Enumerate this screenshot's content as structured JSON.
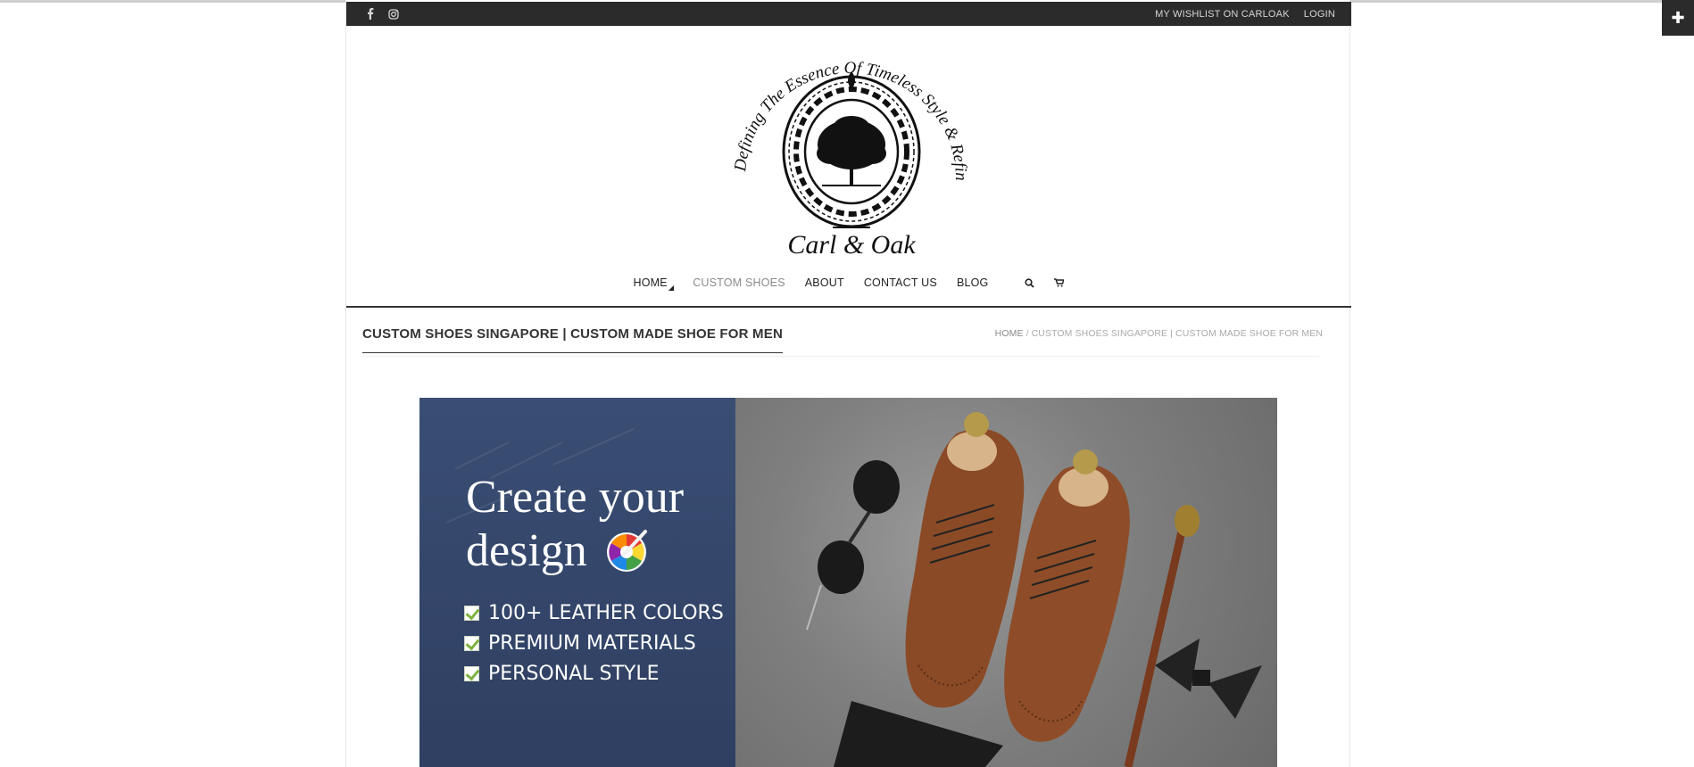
{
  "topbar": {
    "social": [
      {
        "icon": "facebook-icon",
        "glyph": "f"
      },
      {
        "icon": "instagram-icon",
        "glyph": ""
      }
    ],
    "wishlist_label": "MY WISHLIST ON CARLOAK",
    "login_label": "LOGIN"
  },
  "logo": {
    "arc_text": "Defining The Essence Of Timeless Style & Refined Quality",
    "brand": "Carl & Oak"
  },
  "nav": {
    "items": [
      {
        "label": "HOME",
        "active": false
      },
      {
        "label": "CUSTOM SHOES",
        "active": true
      },
      {
        "label": "ABOUT",
        "active": false
      },
      {
        "label": "CONTACT US",
        "active": false
      },
      {
        "label": "BLOG",
        "active": false
      }
    ],
    "search_icon": "search-icon",
    "cart_icon": "cart-icon"
  },
  "page": {
    "title": "CUSTOM SHOES SINGAPORE | CUSTOM MADE SHOE FOR MEN",
    "breadcrumb_home": "HOME",
    "breadcrumb_sep": " / ",
    "breadcrumb_current": "CUSTOM SHOES SINGAPORE | CUSTOM MADE SHOE FOR MEN"
  },
  "hero": {
    "headline_line1": "Create your",
    "headline_line2": "design",
    "features": [
      "100+ LEATHER COLORS",
      "PREMIUM MATERIALS",
      "PERSONAL STYLE"
    ]
  },
  "corner_button": {
    "icon": "plus-icon",
    "glyph": "✚"
  },
  "colors": {
    "topbar": "#2b2b2b",
    "hero_panel": "#34466a",
    "check_green": "#7db340",
    "shoe_leather": "#8a4a26"
  }
}
